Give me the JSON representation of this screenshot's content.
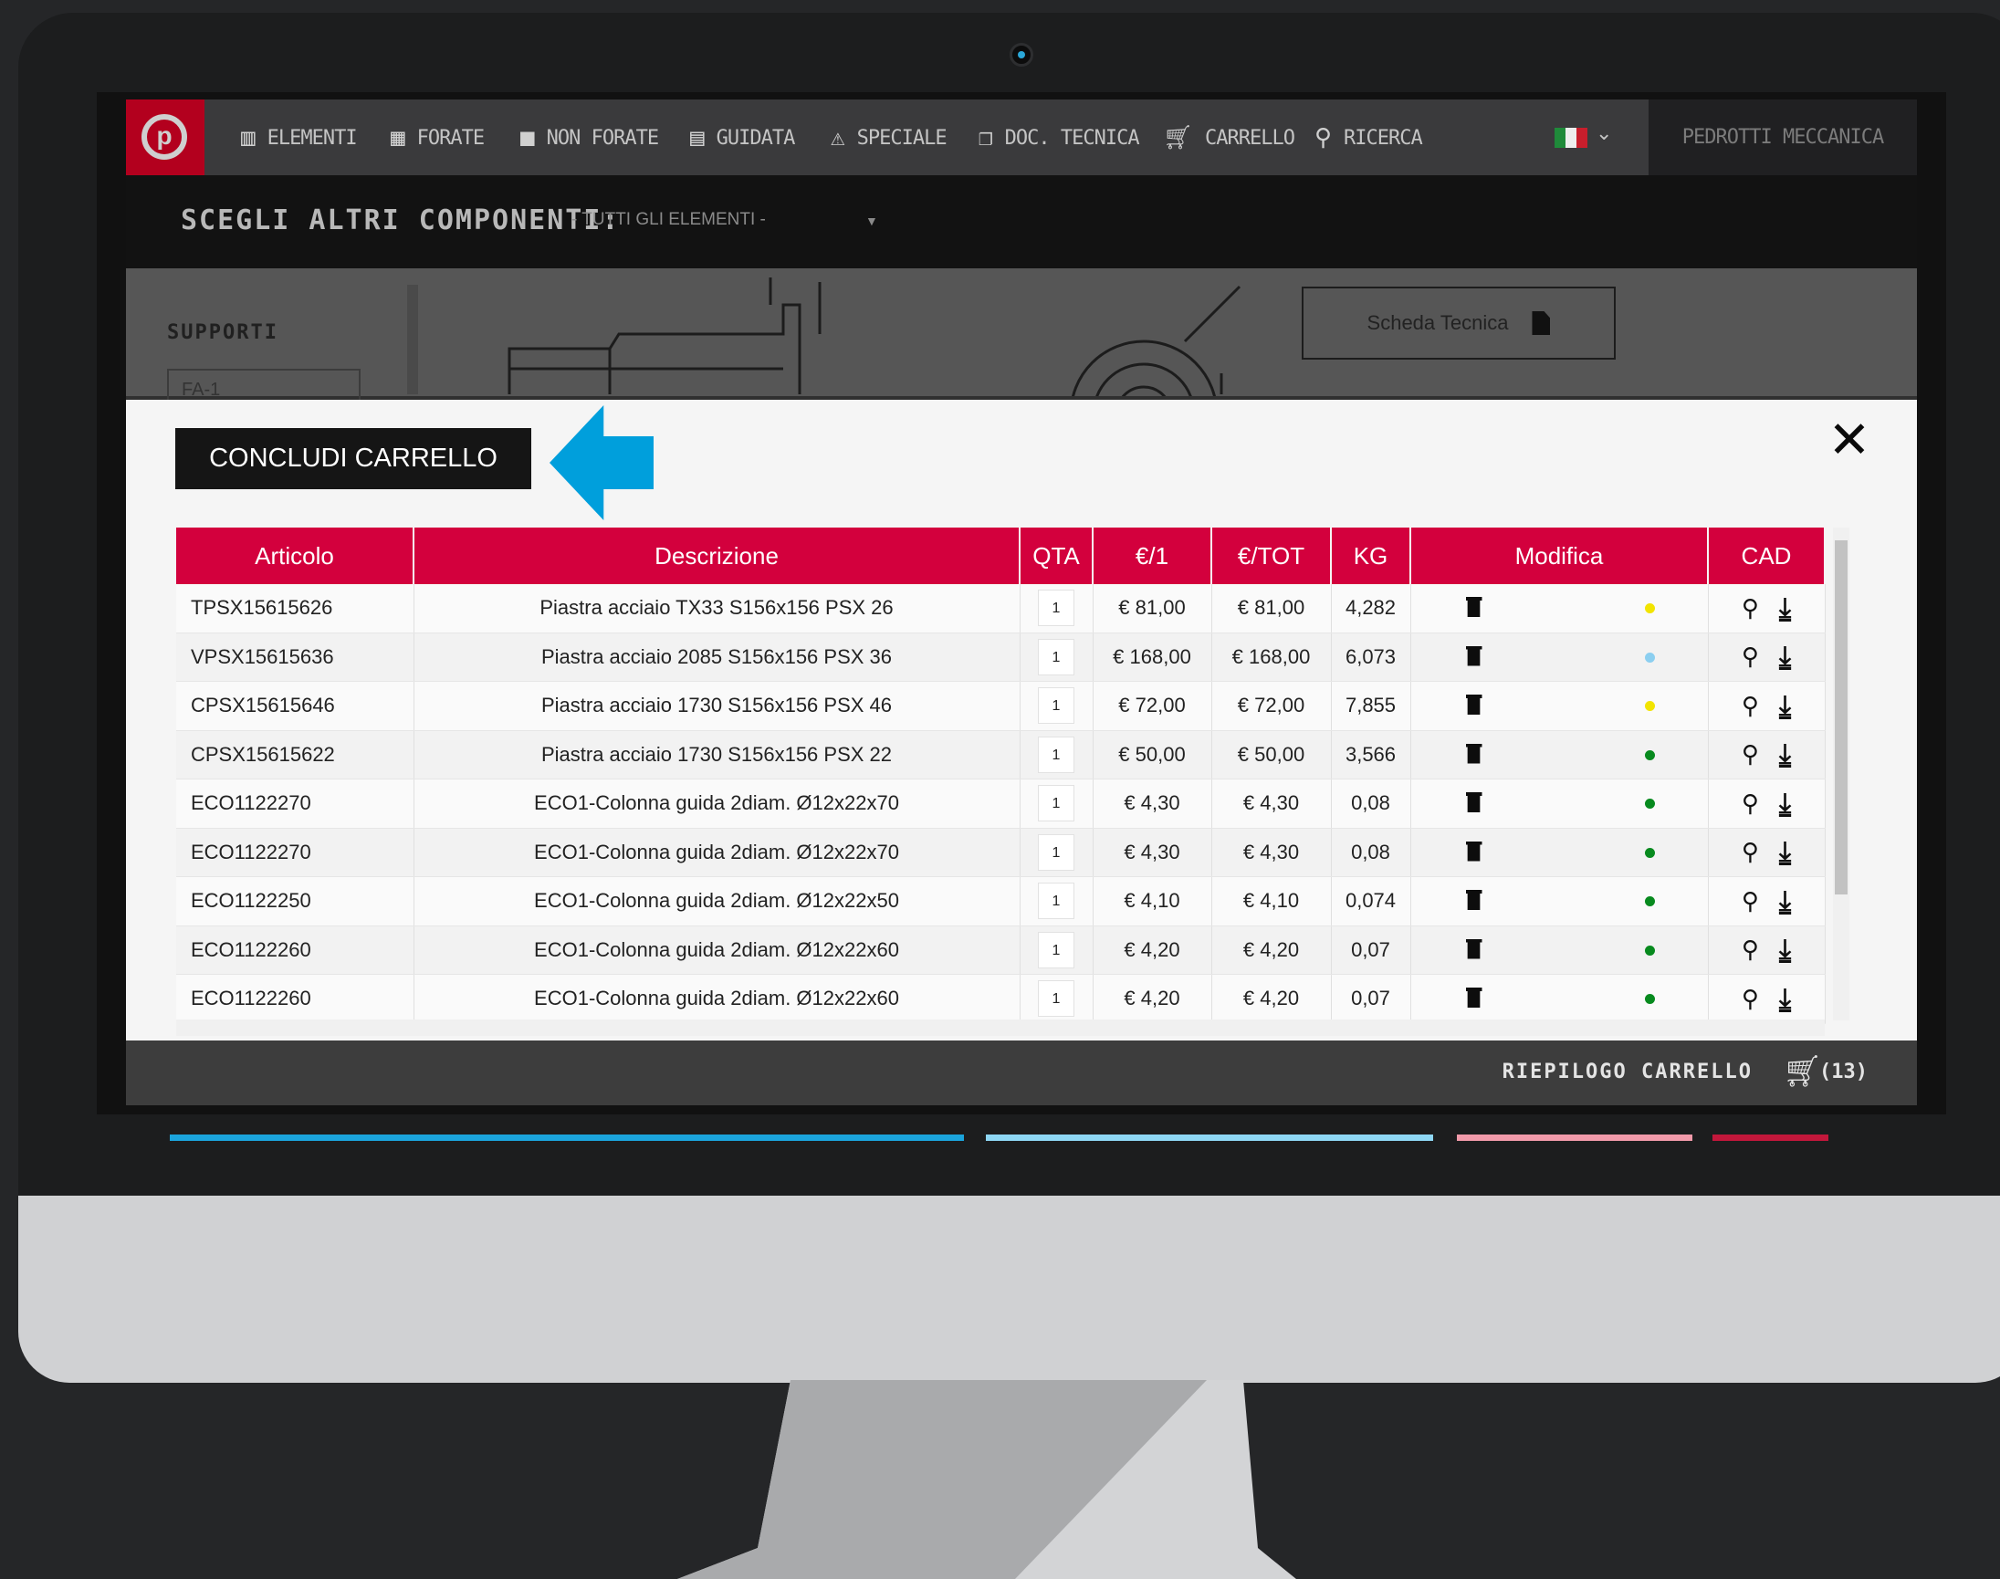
{
  "nav": {
    "items": [
      {
        "label": "ELEMENTI",
        "icon": "bar-chart-icon"
      },
      {
        "label": "FORATE",
        "icon": "perforated-plate-icon"
      },
      {
        "label": "NON FORATE",
        "icon": "solid-plate-icon"
      },
      {
        "label": "GUIDATA",
        "icon": "guided-plate-icon"
      },
      {
        "label": "SPECIALE",
        "icon": "warning-icon"
      },
      {
        "label": "DOC. TECNICA",
        "icon": "documents-icon"
      },
      {
        "label": "CARRELLO",
        "icon": "cart-icon"
      },
      {
        "label": "RICERCA",
        "icon": "search-icon"
      }
    ],
    "language_flag": "italian-flag-icon",
    "brand": "PEDROTTI MECCANICA"
  },
  "subbar": {
    "label": "SCEGLI ALTRI COMPONENTI:",
    "select_value": "- TUTTI GLI ELEMENTI -"
  },
  "background": {
    "section_label": "SUPPORTI",
    "input_value": "FA-1",
    "scheda_button": "Scheda Tecnica"
  },
  "modal": {
    "conclude_button": "CONCLUDI CARRELLO",
    "close_symbol": "✕",
    "columns": [
      "Articolo",
      "Descrizione",
      "QTA",
      "€/1",
      "€/TOT",
      "KG",
      "Modifica",
      "CAD"
    ],
    "rows": [
      {
        "articolo": "TPSX15615626",
        "descrizione": "Piastra acciaio TX33 S156x156 PSX 26",
        "qta": "1",
        "unit": "€ 81,00",
        "tot": "€ 81,00",
        "kg": "4,282",
        "status_color": "#f2e400"
      },
      {
        "articolo": "VPSX15615636",
        "descrizione": "Piastra acciaio 2085 S156x156 PSX 36",
        "qta": "1",
        "unit": "€ 168,00",
        "tot": "€ 168,00",
        "kg": "6,073",
        "status_color": "#8ccff0"
      },
      {
        "articolo": "CPSX15615646",
        "descrizione": "Piastra acciaio 1730 S156x156 PSX 46",
        "qta": "1",
        "unit": "€ 72,00",
        "tot": "€ 72,00",
        "kg": "7,855",
        "status_color": "#f2e400"
      },
      {
        "articolo": "CPSX15615622",
        "descrizione": "Piastra acciaio 1730 S156x156 PSX 22",
        "qta": "1",
        "unit": "€ 50,00",
        "tot": "€ 50,00",
        "kg": "3,566",
        "status_color": "#078a1e"
      },
      {
        "articolo": "ECO1122270",
        "descrizione": "ECO1-Colonna guida 2diam. Ø12x22x70",
        "qta": "1",
        "unit": "€ 4,30",
        "tot": "€ 4,30",
        "kg": "0,08",
        "status_color": "#078a1e"
      },
      {
        "articolo": "ECO1122270",
        "descrizione": "ECO1-Colonna guida 2diam. Ø12x22x70",
        "qta": "1",
        "unit": "€ 4,30",
        "tot": "€ 4,30",
        "kg": "0,08",
        "status_color": "#078a1e"
      },
      {
        "articolo": "ECO1122250",
        "descrizione": "ECO1-Colonna guida 2diam. Ø12x22x50",
        "qta": "1",
        "unit": "€ 4,10",
        "tot": "€ 4,10",
        "kg": "0,074",
        "status_color": "#078a1e"
      },
      {
        "articolo": "ECO1122260",
        "descrizione": "ECO1-Colonna guida 2diam. Ø12x22x60",
        "qta": "1",
        "unit": "€ 4,20",
        "tot": "€ 4,20",
        "kg": "0,07",
        "status_color": "#078a1e"
      },
      {
        "articolo": "ECO1122260",
        "descrizione": "ECO1-Colonna guida 2diam. Ø12x22x60",
        "qta": "1",
        "unit": "€ 4,20",
        "tot": "€ 4,20",
        "kg": "0,07",
        "status_color": "#078a1e"
      }
    ]
  },
  "footer": {
    "riepilogo_label": "RIEPILOGO CARRELLO",
    "cart_count": "(13)"
  },
  "colors": {
    "header_red": "#d3003d",
    "accent_blue": "#009fdc",
    "logo_red": "#b3001e",
    "stripe_colors": [
      "#1ba4dc",
      "#8ed7f4",
      "#f19aaa",
      "#c2173b"
    ]
  }
}
